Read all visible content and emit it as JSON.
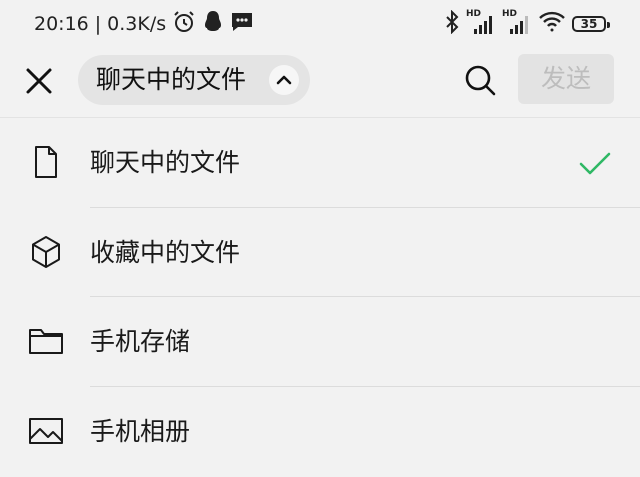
{
  "status_bar": {
    "time": "20:16",
    "separator": "|",
    "net_speed": "0.3K/s",
    "icons": [
      "alarm-icon",
      "qq-penguin-icon",
      "message-icon",
      "bluetooth-icon",
      "signal-hd-icon",
      "signal-hd-icon",
      "wifi-icon"
    ],
    "signal_labels": [
      "HD",
      "HD"
    ],
    "battery_level": "35"
  },
  "top_bar": {
    "close_icon": "close-icon",
    "dropdown_label": "聊天中的文件",
    "dropdown_icon": "chevron-up-icon",
    "search_icon": "search-icon",
    "send_label": "发送"
  },
  "menu": {
    "items": [
      {
        "label": "聊天中的文件",
        "icon": "document-icon",
        "selected": true
      },
      {
        "label": "收藏中的文件",
        "icon": "cube-icon",
        "selected": false
      },
      {
        "label": "手机存储",
        "icon": "folder-icon",
        "selected": false
      },
      {
        "label": "手机相册",
        "icon": "image-icon",
        "selected": false
      }
    ]
  },
  "colors": {
    "background": "#f2f2f2",
    "check": "#2fb865",
    "send_disabled_bg": "#e3e3e3",
    "send_disabled_text": "#bdbdbd"
  }
}
